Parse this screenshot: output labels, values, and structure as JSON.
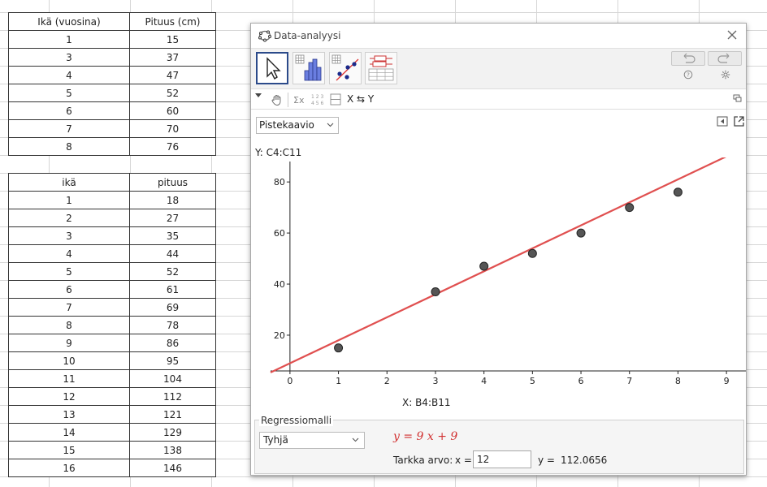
{
  "table1": {
    "headers": [
      "Ikä (vuosina)",
      "Pituus (cm)"
    ],
    "rows": [
      [
        "1",
        "15"
      ],
      [
        "3",
        "37"
      ],
      [
        "4",
        "47"
      ],
      [
        "5",
        "52"
      ],
      [
        "6",
        "60"
      ],
      [
        "7",
        "70"
      ],
      [
        "8",
        "76"
      ]
    ]
  },
  "table2": {
    "headers": [
      "ikä",
      "pituus"
    ],
    "rows": [
      [
        "1",
        "18"
      ],
      [
        "2",
        "27"
      ],
      [
        "3",
        "35"
      ],
      [
        "4",
        "44"
      ],
      [
        "5",
        "52"
      ],
      [
        "6",
        "61"
      ],
      [
        "7",
        "69"
      ],
      [
        "8",
        "78"
      ],
      [
        "9",
        "86"
      ],
      [
        "10",
        "95"
      ],
      [
        "11",
        "104"
      ],
      [
        "12",
        "112"
      ],
      [
        "13",
        "121"
      ],
      [
        "14",
        "129"
      ],
      [
        "15",
        "138"
      ],
      [
        "16",
        "146"
      ]
    ]
  },
  "dialog": {
    "title": "Data-analyysi",
    "subtool_swap": "X ⇆ Y",
    "plot_type": "Pistekaavio",
    "y_source": "Y:  C4:C11",
    "x_source": "X:  B4:B11"
  },
  "chart_data": {
    "type": "scatter",
    "x": [
      1,
      3,
      4,
      5,
      6,
      7,
      8
    ],
    "y": [
      15,
      37,
      47,
      52,
      60,
      70,
      76
    ],
    "xlim": [
      -0.4,
      9.4
    ],
    "ylim": [
      6,
      88
    ],
    "xticks": [
      "0",
      "1",
      "2",
      "3",
      "4",
      "5",
      "6",
      "7",
      "8",
      "9"
    ],
    "yticks": [
      "20",
      "40",
      "60",
      "80"
    ],
    "regression": {
      "slope": 9,
      "intercept": 9,
      "color": "#e05050"
    },
    "point_color": "#555555"
  },
  "regression": {
    "title": "Regressiomalli",
    "model": "Tyhjä",
    "equation": "y = 9 x + 9",
    "exact_label": "Tarkka arvo:",
    "x_label": "x =",
    "x_value": "12",
    "y_label": "y =",
    "y_value": "112.0656"
  }
}
